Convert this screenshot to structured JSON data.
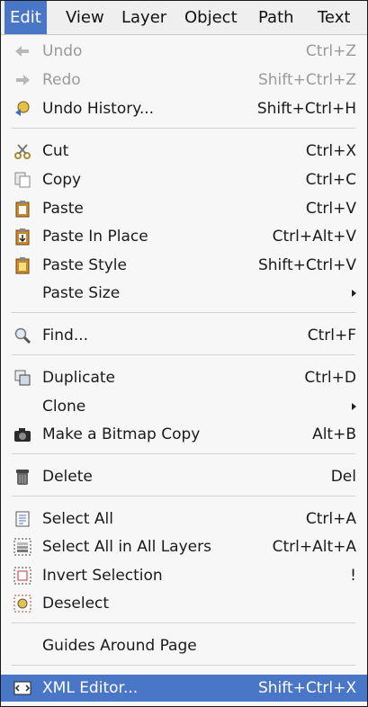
{
  "menubar": {
    "edit": "Edit",
    "view": "View",
    "layer": "Layer",
    "object": "Object",
    "path": "Path",
    "text": "Text"
  },
  "menu": {
    "undo": {
      "label": "Undo",
      "shortcut": "Ctrl+Z",
      "icon": "undo-icon",
      "state": "disabled"
    },
    "redo": {
      "label": "Redo",
      "shortcut": "Shift+Ctrl+Z",
      "icon": "redo-icon",
      "state": "disabled"
    },
    "undo_history": {
      "label": "Undo History...",
      "shortcut": "Shift+Ctrl+H",
      "icon": "undo-history-icon"
    },
    "cut": {
      "label": "Cut",
      "shortcut": "Ctrl+X",
      "icon": "scissors-icon"
    },
    "copy": {
      "label": "Copy",
      "shortcut": "Ctrl+C",
      "icon": "copy-icon"
    },
    "paste": {
      "label": "Paste",
      "shortcut": "Ctrl+V",
      "icon": "paste-icon"
    },
    "paste_in_place": {
      "label": "Paste In Place",
      "shortcut": "Ctrl+Alt+V",
      "icon": "paste-in-place-icon"
    },
    "paste_style": {
      "label": "Paste Style",
      "shortcut": "Shift+Ctrl+V",
      "icon": "paste-style-icon"
    },
    "paste_size": {
      "label": "Paste Size"
    },
    "find": {
      "label": "Find...",
      "shortcut": "Ctrl+F",
      "icon": "magnifier-icon"
    },
    "duplicate": {
      "label": "Duplicate",
      "shortcut": "Ctrl+D",
      "icon": "duplicate-icon"
    },
    "clone": {
      "label": "Clone"
    },
    "bitmap_copy": {
      "label": "Make a Bitmap Copy",
      "shortcut": "Alt+B",
      "icon": "camera-icon"
    },
    "delete": {
      "label": "Delete",
      "shortcut": "Del",
      "icon": "trash-icon"
    },
    "select_all": {
      "label": "Select All",
      "shortcut": "Ctrl+A",
      "icon": "select-all-icon"
    },
    "select_all_layers": {
      "label": "Select All in All Layers",
      "shortcut": "Ctrl+Alt+A",
      "icon": "select-all-layers-icon"
    },
    "invert_selection": {
      "label": "Invert Selection",
      "shortcut": "!",
      "icon": "invert-selection-icon"
    },
    "deselect": {
      "label": "Deselect",
      "icon": "deselect-icon"
    },
    "guides_around_page": {
      "label": "Guides Around Page"
    },
    "xml_editor": {
      "label": "XML Editor...",
      "shortcut": "Shift+Ctrl+X",
      "icon": "xml-editor-icon",
      "state": "selected"
    }
  },
  "colors": {
    "highlight": "#4a76c8",
    "menu_bg": "#f7f7f7",
    "disabled_text": "#9a9a9a"
  }
}
